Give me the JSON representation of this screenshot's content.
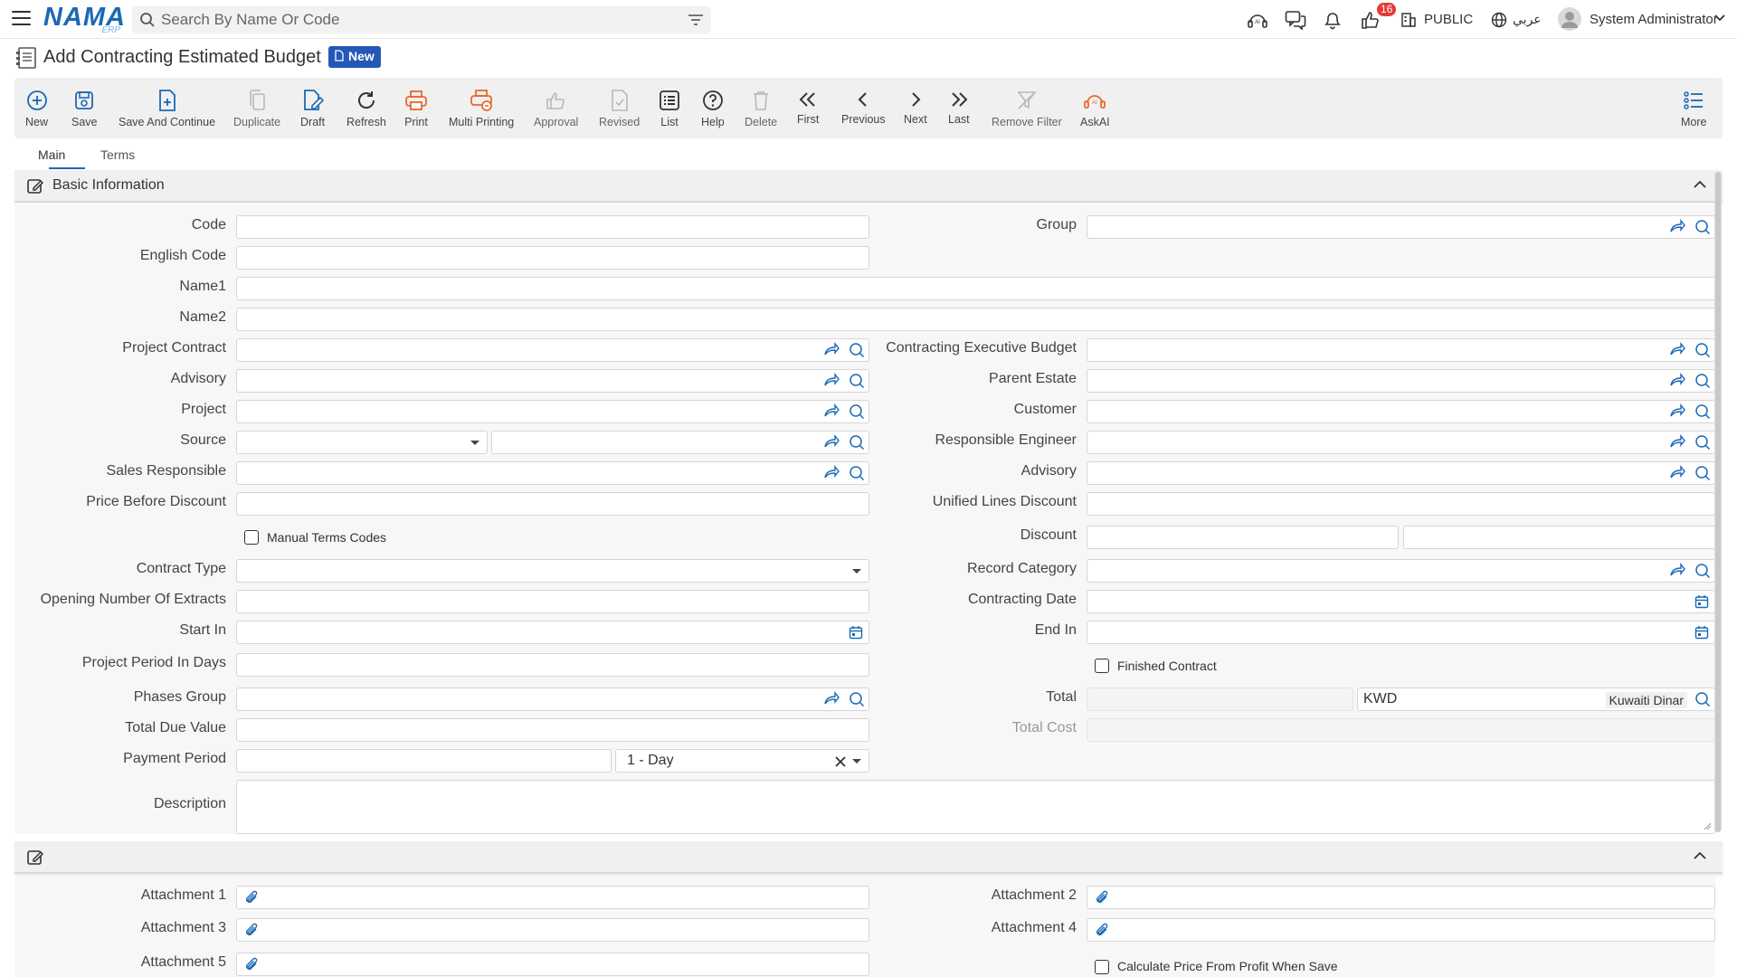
{
  "header": {
    "logo_text": "NAMA",
    "logo_sub": "ERP",
    "search_placeholder": "Search By Name Or Code",
    "notification_count": "16",
    "public_label": "PUBLIC",
    "language_label": "عربي",
    "user_name": "System Administrator"
  },
  "page": {
    "title": "Add Contracting Estimated Budget",
    "status_badge": "New"
  },
  "toolbar": {
    "new": "New",
    "save": "Save",
    "save_continue": "Save And Continue",
    "duplicate": "Duplicate",
    "draft": "Draft",
    "refresh": "Refresh",
    "print": "Print",
    "multi_printing": "Multi Printing",
    "approval": "Approval",
    "revised": "Revised",
    "list": "List",
    "help": "Help",
    "delete": "Delete",
    "first": "First",
    "previous": "Previous",
    "next": "Next",
    "last": "Last",
    "remove_filter": "Remove Filter",
    "askai": "AskAI",
    "more": "More"
  },
  "tabs": [
    "Main",
    "Terms"
  ],
  "sections": {
    "basic": "Basic Information"
  },
  "labels": {
    "code": "Code",
    "english_code": "English Code",
    "name1": "Name1",
    "name2": "Name2",
    "project_contract": "Project Contract",
    "advisory": "Advisory",
    "project": "Project",
    "source": "Source",
    "sales_responsible": "Sales Responsible",
    "price_before_discount": "Price Before Discount",
    "manual_terms_codes": "Manual Terms Codes",
    "contract_type": "Contract Type",
    "opening_number_extracts": "Opening Number Of Extracts",
    "start_in": "Start In",
    "project_period_days": "Project Period In Days",
    "phases_group": "Phases Group",
    "total_due_value": "Total Due Value",
    "payment_period": "Payment Period",
    "description": "Description",
    "group": "Group",
    "contracting_exec_budget": "Contracting Executive Budget",
    "parent_estate": "Parent Estate",
    "customer": "Customer",
    "responsible_engineer": "Responsible Engineer",
    "advisory2": "Advisory",
    "unified_lines_discount": "Unified Lines Discount",
    "discount": "Discount",
    "record_category": "Record Category",
    "contracting_date": "Contracting Date",
    "end_in": "End In",
    "finished_contract": "Finished Contract",
    "total": "Total",
    "total_cost": "Total Cost",
    "attachment1": "Attachment 1",
    "attachment2": "Attachment 2",
    "attachment3": "Attachment 3",
    "attachment4": "Attachment 4",
    "attachment5": "Attachment 5",
    "calc_price_profit": "Calculate Price From Profit When Save"
  },
  "values": {
    "payment_period_unit": "1 - Day",
    "currency_code": "KWD",
    "currency_name": "Kuwaiti Dinar"
  },
  "colors": {
    "brand": "#1b69b4",
    "badge_bg": "#2458b8",
    "notification": "#e53935",
    "action_orange": "#e8692c"
  }
}
